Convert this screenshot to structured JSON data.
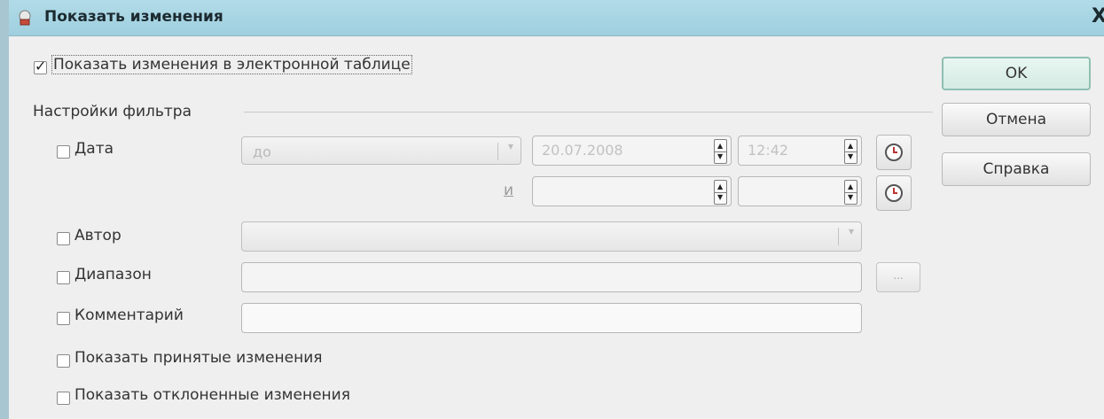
{
  "window": {
    "title": "Показать изменения",
    "close_label": "X"
  },
  "show_changes": {
    "label": "Показать изменения в электронной таблице",
    "checked": true
  },
  "filter": {
    "section_label": "Настройки фильтра",
    "date": {
      "label": "Дата",
      "mode_value": "до",
      "date_value": "20.07.2008",
      "time_value": "12:42",
      "and_label": "и"
    },
    "author": {
      "label": "Автор",
      "value": ""
    },
    "range": {
      "label": "Диапазон",
      "value": "",
      "picker_label": "..."
    },
    "comment": {
      "label": "Комментарий",
      "value": ""
    },
    "show_accepted": {
      "label": "Показать принятые изменения"
    },
    "show_rejected": {
      "label": "Показать отклоненные изменения"
    }
  },
  "buttons": {
    "ok": "OK",
    "cancel": "Отмена",
    "help": "Справка"
  },
  "colors": {
    "titlebar": "#a8d4e3",
    "default_button": "#d4ebe3",
    "dialog_bg": "#efefef"
  }
}
